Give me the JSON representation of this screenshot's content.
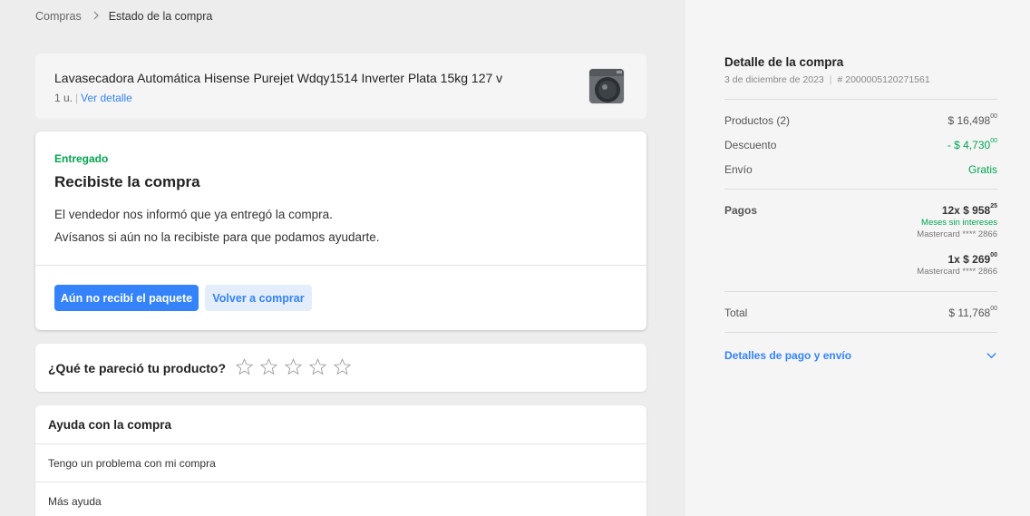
{
  "breadcrumb": {
    "parent": "Compras",
    "current": "Estado de la compra"
  },
  "product": {
    "title": "Lavasecadora Automática Hisense Purejet Wdqy1514 Inverter Plata 15kg 127 v",
    "quantity": "1 u.",
    "separator": "|",
    "detail_link": "Ver detalle"
  },
  "status": {
    "label": "Entregado",
    "title": "Recibiste la compra",
    "message_1": "El vendedor nos informó que ya entregó la compra.",
    "message_2": "Avísanos si aún no la recibiste para que podamos ayudarte.",
    "primary_button": "Aún no recibí el paquete",
    "secondary_button": "Volver a comprar"
  },
  "rating": {
    "question": "¿Qué te pareció tu producto?",
    "stars": 5,
    "filled": 0
  },
  "help": {
    "title": "Ayuda con la compra",
    "items": [
      "Tengo un problema con mi compra",
      "Más ayuda"
    ]
  },
  "summary": {
    "title": "Detalle de la compra",
    "date": "3 de diciembre de 2023",
    "order_number": "# 2000005120271561",
    "products_label": "Productos (2)",
    "products_amount": "$ 16,498",
    "products_cents": "00",
    "discount_label": "Descuento",
    "discount_amount": "- $ 4,730",
    "discount_cents": "00",
    "shipping_label": "Envío",
    "shipping_value": "Gratis",
    "payments_label": "Pagos",
    "payment_1_amount": "12x $ 958",
    "payment_1_cents": "25",
    "payment_1_note": "Meses sin intereses",
    "payment_1_card": "Mastercard **** 2866",
    "payment_2_amount": "1x $ 269",
    "payment_2_cents": "00",
    "payment_2_card": "Mastercard **** 2866",
    "total_label": "Total",
    "total_amount": "$ 11,768",
    "total_cents": "00",
    "details_link": "Detalles de pago y envío"
  },
  "colors": {
    "accent": "#3483fa",
    "success": "#00a650",
    "secondary_bg": "#e3edfb"
  }
}
